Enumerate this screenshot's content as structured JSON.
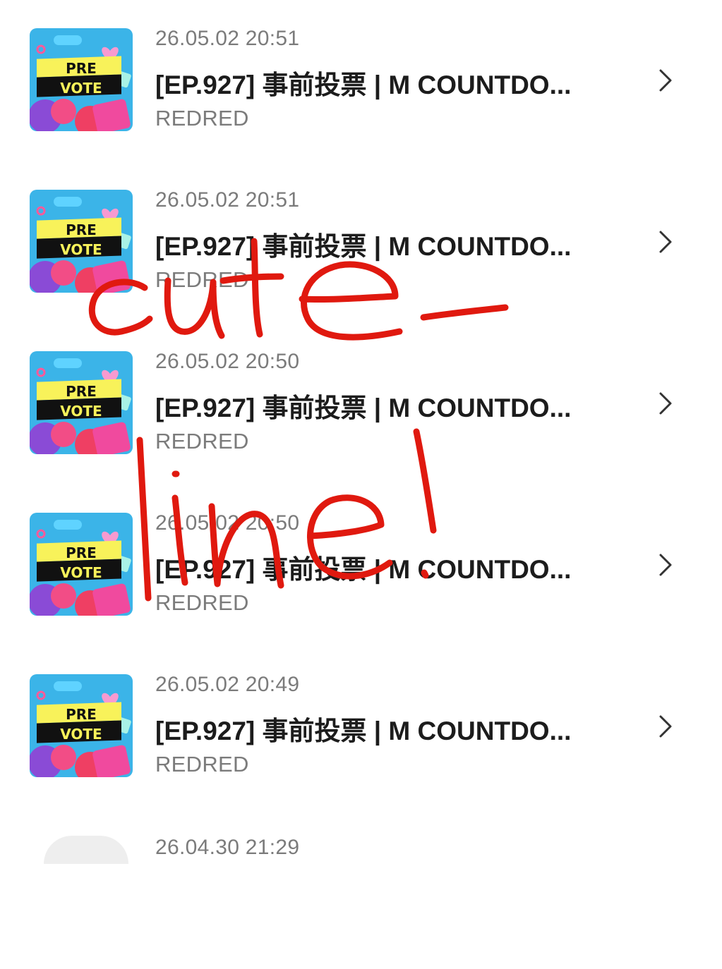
{
  "list": {
    "items": [
      {
        "date": "26.05.02 20:51",
        "title": "[EP.927] 事前投票 | M COUNTDO...",
        "subtitle": "REDRED",
        "thumb": {
          "line1": "PRE",
          "line2": "VOTE"
        }
      },
      {
        "date": "26.05.02 20:51",
        "title": "[EP.927] 事前投票 | M COUNTDO...",
        "subtitle": "REDRED",
        "thumb": {
          "line1": "PRE",
          "line2": "VOTE"
        }
      },
      {
        "date": "26.05.02 20:50",
        "title": "[EP.927] 事前投票 | M COUNTDO...",
        "subtitle": "REDRED",
        "thumb": {
          "line1": "PRE",
          "line2": "VOTE"
        }
      },
      {
        "date": "26.05.02 20:50",
        "title": "[EP.927] 事前投票 | M COUNTDO...",
        "subtitle": "REDRED",
        "thumb": {
          "line1": "PRE",
          "line2": "VOTE"
        }
      },
      {
        "date": "26.05.02 20:49",
        "title": "[EP.927] 事前投票 | M COUNTDO...",
        "subtitle": "REDRED",
        "thumb": {
          "line1": "PRE",
          "line2": "VOTE"
        }
      },
      {
        "date": "26.04.30 21:29"
      }
    ],
    "chevron_icon": "chevron-right-icon"
  },
  "annotation": {
    "handwriting": "cute-line!",
    "color": "#e0190f"
  },
  "colors": {
    "date_text": "#7b7b7b",
    "title_text": "#1c1c1c",
    "thumb_background": "#3bb4e8",
    "thumb_banner": "#f8f25a"
  }
}
